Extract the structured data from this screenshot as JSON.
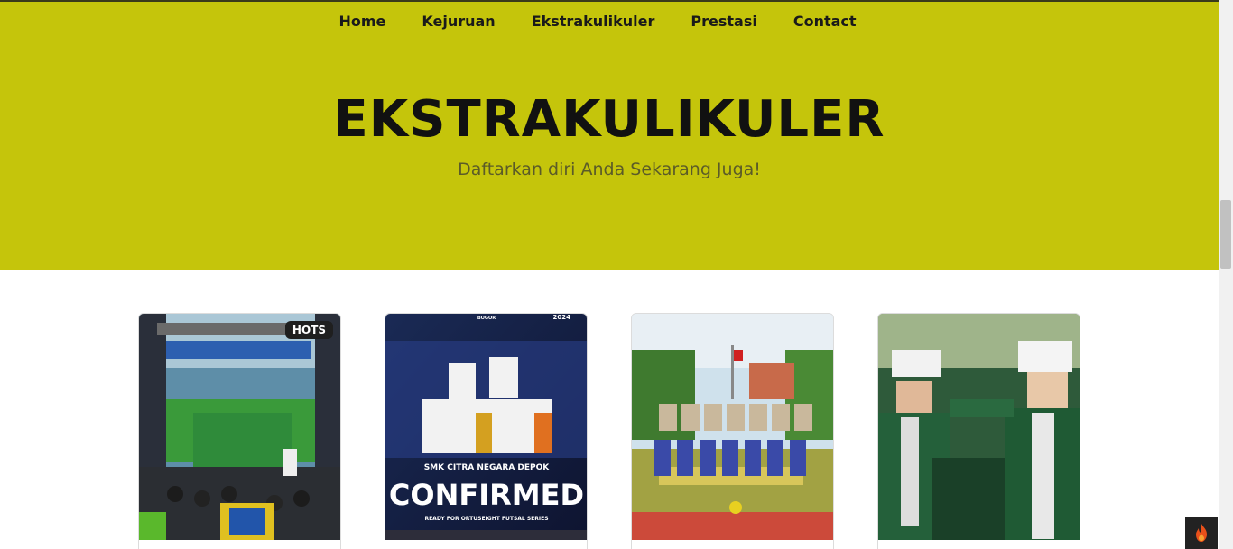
{
  "nav": {
    "items": [
      "Home",
      "Kejuruan",
      "Ekstrakulikuler",
      "Prestasi",
      "Contact"
    ]
  },
  "hero": {
    "title": "EKSTRAKULIKULER",
    "subtitle": "Daftarkan diri Anda Sekarang Juga!"
  },
  "cards": [
    {
      "badge": "HOTS",
      "image": "music-stage-photo"
    },
    {
      "image": "futsal-team-poster",
      "poster_text": "SMK CITRA NEGARA DEPOK",
      "poster_headline": "CONFIRMED",
      "poster_tagline": "READY FOR ORTUSEIGHT FUTSAL SERIES",
      "poster_year": "2024",
      "poster_city": "BOGOR"
    },
    {
      "image": "volleyball-team-photo"
    },
    {
      "image": "marching-band-photo"
    }
  ],
  "colors": {
    "hero_bg": "#c5c50b",
    "nav_text": "#1a1a1a",
    "title_text": "#111111",
    "subtitle_text": "#5b5b28"
  },
  "floating_button": {
    "icon": "fire-icon"
  }
}
